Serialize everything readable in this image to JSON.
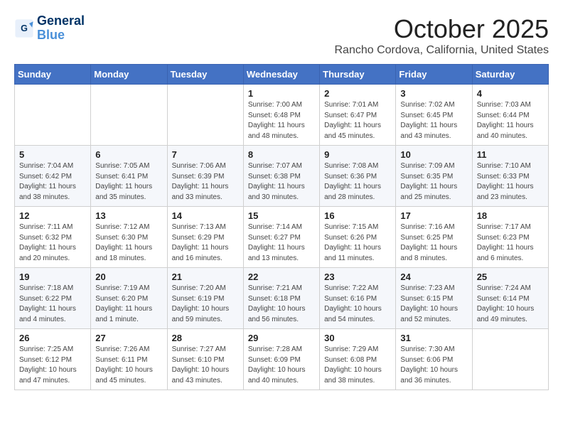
{
  "logo": {
    "line1": "General",
    "line2": "Blue"
  },
  "header": {
    "month": "October 2025",
    "location": "Rancho Cordova, California, United States"
  },
  "weekdays": [
    "Sunday",
    "Monday",
    "Tuesday",
    "Wednesday",
    "Thursday",
    "Friday",
    "Saturday"
  ],
  "weeks": [
    [
      {
        "day": "",
        "info": ""
      },
      {
        "day": "",
        "info": ""
      },
      {
        "day": "",
        "info": ""
      },
      {
        "day": "1",
        "info": "Sunrise: 7:00 AM\nSunset: 6:48 PM\nDaylight: 11 hours\nand 48 minutes."
      },
      {
        "day": "2",
        "info": "Sunrise: 7:01 AM\nSunset: 6:47 PM\nDaylight: 11 hours\nand 45 minutes."
      },
      {
        "day": "3",
        "info": "Sunrise: 7:02 AM\nSunset: 6:45 PM\nDaylight: 11 hours\nand 43 minutes."
      },
      {
        "day": "4",
        "info": "Sunrise: 7:03 AM\nSunset: 6:44 PM\nDaylight: 11 hours\nand 40 minutes."
      }
    ],
    [
      {
        "day": "5",
        "info": "Sunrise: 7:04 AM\nSunset: 6:42 PM\nDaylight: 11 hours\nand 38 minutes."
      },
      {
        "day": "6",
        "info": "Sunrise: 7:05 AM\nSunset: 6:41 PM\nDaylight: 11 hours\nand 35 minutes."
      },
      {
        "day": "7",
        "info": "Sunrise: 7:06 AM\nSunset: 6:39 PM\nDaylight: 11 hours\nand 33 minutes."
      },
      {
        "day": "8",
        "info": "Sunrise: 7:07 AM\nSunset: 6:38 PM\nDaylight: 11 hours\nand 30 minutes."
      },
      {
        "day": "9",
        "info": "Sunrise: 7:08 AM\nSunset: 6:36 PM\nDaylight: 11 hours\nand 28 minutes."
      },
      {
        "day": "10",
        "info": "Sunrise: 7:09 AM\nSunset: 6:35 PM\nDaylight: 11 hours\nand 25 minutes."
      },
      {
        "day": "11",
        "info": "Sunrise: 7:10 AM\nSunset: 6:33 PM\nDaylight: 11 hours\nand 23 minutes."
      }
    ],
    [
      {
        "day": "12",
        "info": "Sunrise: 7:11 AM\nSunset: 6:32 PM\nDaylight: 11 hours\nand 20 minutes."
      },
      {
        "day": "13",
        "info": "Sunrise: 7:12 AM\nSunset: 6:30 PM\nDaylight: 11 hours\nand 18 minutes."
      },
      {
        "day": "14",
        "info": "Sunrise: 7:13 AM\nSunset: 6:29 PM\nDaylight: 11 hours\nand 16 minutes."
      },
      {
        "day": "15",
        "info": "Sunrise: 7:14 AM\nSunset: 6:27 PM\nDaylight: 11 hours\nand 13 minutes."
      },
      {
        "day": "16",
        "info": "Sunrise: 7:15 AM\nSunset: 6:26 PM\nDaylight: 11 hours\nand 11 minutes."
      },
      {
        "day": "17",
        "info": "Sunrise: 7:16 AM\nSunset: 6:25 PM\nDaylight: 11 hours\nand 8 minutes."
      },
      {
        "day": "18",
        "info": "Sunrise: 7:17 AM\nSunset: 6:23 PM\nDaylight: 11 hours\nand 6 minutes."
      }
    ],
    [
      {
        "day": "19",
        "info": "Sunrise: 7:18 AM\nSunset: 6:22 PM\nDaylight: 11 hours\nand 4 minutes."
      },
      {
        "day": "20",
        "info": "Sunrise: 7:19 AM\nSunset: 6:20 PM\nDaylight: 11 hours\nand 1 minute."
      },
      {
        "day": "21",
        "info": "Sunrise: 7:20 AM\nSunset: 6:19 PM\nDaylight: 10 hours\nand 59 minutes."
      },
      {
        "day": "22",
        "info": "Sunrise: 7:21 AM\nSunset: 6:18 PM\nDaylight: 10 hours\nand 56 minutes."
      },
      {
        "day": "23",
        "info": "Sunrise: 7:22 AM\nSunset: 6:16 PM\nDaylight: 10 hours\nand 54 minutes."
      },
      {
        "day": "24",
        "info": "Sunrise: 7:23 AM\nSunset: 6:15 PM\nDaylight: 10 hours\nand 52 minutes."
      },
      {
        "day": "25",
        "info": "Sunrise: 7:24 AM\nSunset: 6:14 PM\nDaylight: 10 hours\nand 49 minutes."
      }
    ],
    [
      {
        "day": "26",
        "info": "Sunrise: 7:25 AM\nSunset: 6:12 PM\nDaylight: 10 hours\nand 47 minutes."
      },
      {
        "day": "27",
        "info": "Sunrise: 7:26 AM\nSunset: 6:11 PM\nDaylight: 10 hours\nand 45 minutes."
      },
      {
        "day": "28",
        "info": "Sunrise: 7:27 AM\nSunset: 6:10 PM\nDaylight: 10 hours\nand 43 minutes."
      },
      {
        "day": "29",
        "info": "Sunrise: 7:28 AM\nSunset: 6:09 PM\nDaylight: 10 hours\nand 40 minutes."
      },
      {
        "day": "30",
        "info": "Sunrise: 7:29 AM\nSunset: 6:08 PM\nDaylight: 10 hours\nand 38 minutes."
      },
      {
        "day": "31",
        "info": "Sunrise: 7:30 AM\nSunset: 6:06 PM\nDaylight: 10 hours\nand 36 minutes."
      },
      {
        "day": "",
        "info": ""
      }
    ]
  ]
}
